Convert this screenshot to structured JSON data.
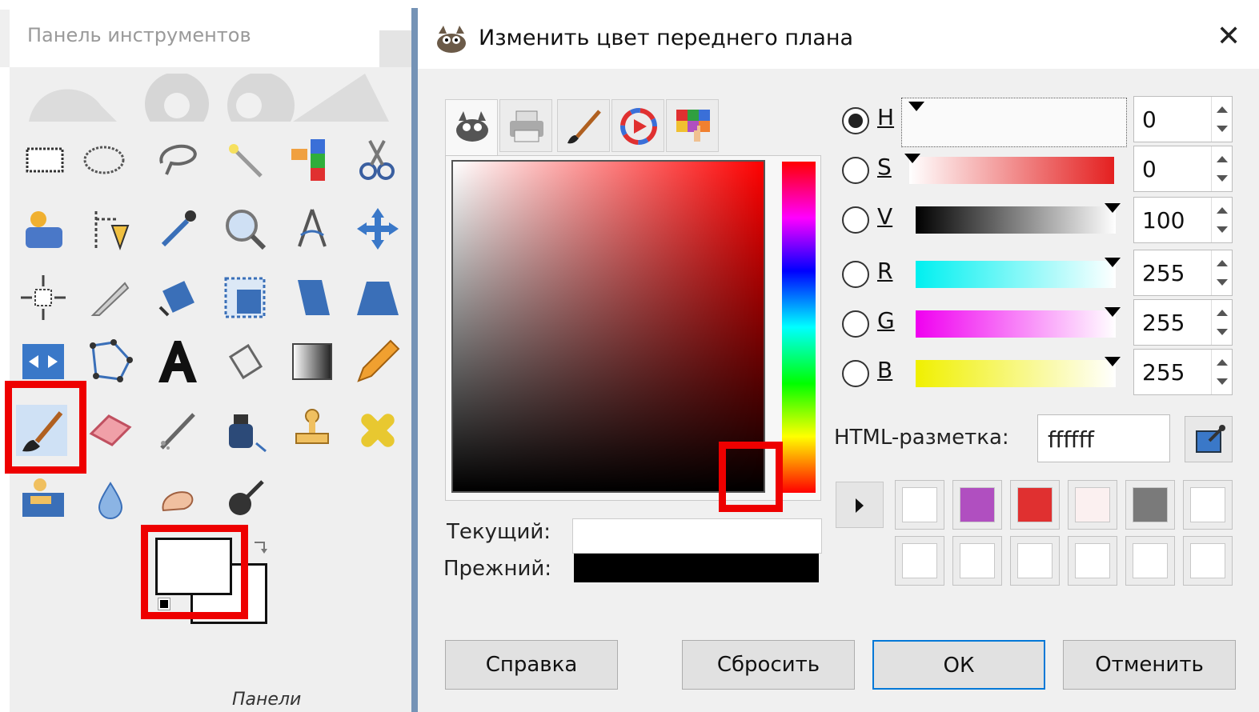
{
  "toolbox": {
    "title": "Панель инструментов",
    "panels_label": "Панели",
    "tools": [
      "rect-select",
      "ellipse-select",
      "free-select",
      "fuzzy-select",
      "select-by-color",
      "scissors-select",
      "foreground-select",
      "paths",
      "color-picker",
      "zoom",
      "measure",
      "move",
      "align",
      "crop",
      "rotate",
      "scale",
      "shear",
      "perspective",
      "flip",
      "cage",
      "text",
      "bucket-fill",
      "blend",
      "pencil",
      "paintbrush",
      "eraser",
      "airbrush",
      "ink",
      "clone",
      "heal",
      "perspective-clone",
      "blur",
      "smudge",
      "dodge-burn"
    ],
    "foreground_color": "#ffffff",
    "background_color": "#ffffff"
  },
  "dialog": {
    "title": "Изменить цвет переднего плана",
    "close_glyph": "✕",
    "channels": [
      {
        "letter": "H",
        "value": "0",
        "checked": true
      },
      {
        "letter": "S",
        "value": "0",
        "checked": false
      },
      {
        "letter": "V",
        "value": "100",
        "checked": false
      },
      {
        "letter": "R",
        "value": "255",
        "checked": false
      },
      {
        "letter": "G",
        "value": "255",
        "checked": false
      },
      {
        "letter": "B",
        "value": "255",
        "checked": false
      }
    ],
    "current_label": "Текущий:",
    "previous_label": "Прежний:",
    "html_label": "HTML-разметка:",
    "html_value": "ffffff",
    "history_colors": [
      "#ffffff",
      "#b04fc0",
      "#e03030",
      "#fbf0f0",
      "#7a7a7a",
      "#ffffff",
      "#ffffff",
      "#ffffff",
      "#ffffff",
      "#ffffff",
      "#ffffff",
      "#ffffff"
    ],
    "buttons": {
      "help": "Справка",
      "reset": "Сбросить",
      "ok": "ОК",
      "cancel": "Отменить"
    }
  },
  "colors": {
    "highlight": "#ee0000",
    "accent": "#0078d7"
  }
}
